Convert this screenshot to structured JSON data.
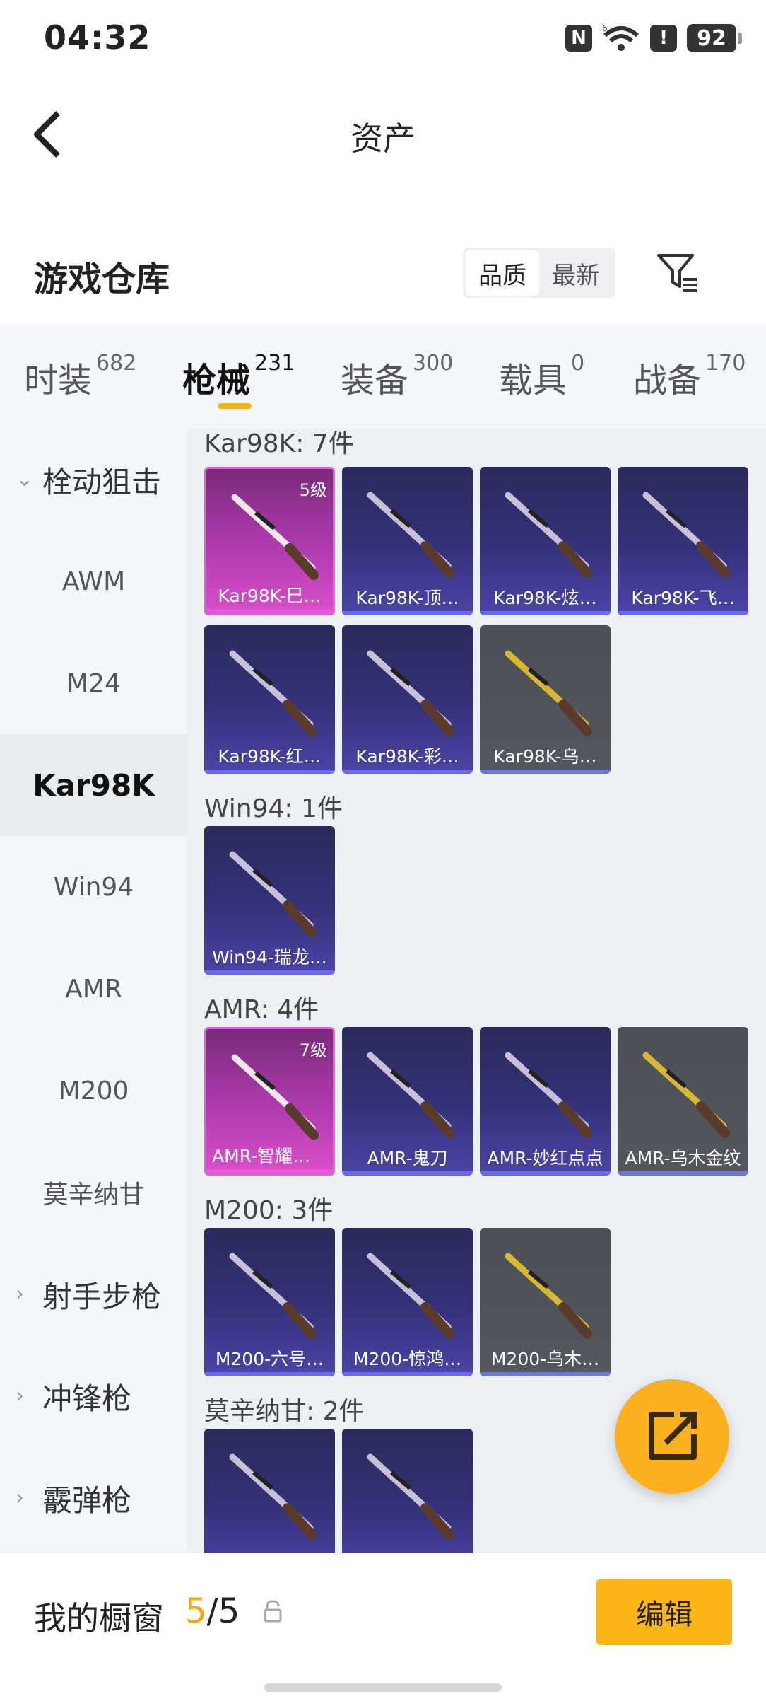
{
  "status_bar": {
    "time": "04:32",
    "battery": "92",
    "signal_label": "6"
  },
  "header": {
    "title": "资产"
  },
  "section": {
    "title": "游戏仓库",
    "sort_options": [
      "品质",
      "最新"
    ],
    "active_sort": "品质"
  },
  "tabs": [
    {
      "label": "时装",
      "count": "682"
    },
    {
      "label": "枪械",
      "count": "231"
    },
    {
      "label": "装备",
      "count": "300"
    },
    {
      "label": "载具",
      "count": "0"
    },
    {
      "label": "战备",
      "count": "170"
    }
  ],
  "active_tab": "枪械",
  "sidebar": {
    "items": [
      {
        "label": "栓动狙击",
        "type": "category",
        "expanded": true
      },
      {
        "label": "AWM",
        "type": "sub"
      },
      {
        "label": "M24",
        "type": "sub"
      },
      {
        "label": "Kar98K",
        "type": "sub",
        "selected": true
      },
      {
        "label": "Win94",
        "type": "sub"
      },
      {
        "label": "AMR",
        "type": "sub"
      },
      {
        "label": "M200",
        "type": "sub"
      },
      {
        "label": "莫辛纳甘",
        "type": "sub"
      },
      {
        "label": "射手步枪",
        "type": "category",
        "expanded": false
      },
      {
        "label": "冲锋枪",
        "type": "category",
        "expanded": false
      },
      {
        "label": "霰弹枪",
        "type": "category",
        "expanded": false
      }
    ]
  },
  "groups": [
    {
      "title": "Kar98K: 7件",
      "items": [
        {
          "name": "Kar98K-巳…",
          "tier": "pink",
          "level": "5级"
        },
        {
          "name": "Kar98K-顶…",
          "tier": "purple"
        },
        {
          "name": "Kar98K-炫…",
          "tier": "purple"
        },
        {
          "name": "Kar98K-飞…",
          "tier": "purple"
        },
        {
          "name": "Kar98K-红…",
          "tier": "purple"
        },
        {
          "name": "Kar98K-彩…",
          "tier": "purple"
        },
        {
          "name": "Kar98K-乌…",
          "tier": "gray"
        }
      ]
    },
    {
      "title": "Win94: 1件",
      "items": [
        {
          "name": "Win94-瑞龙…",
          "tier": "purple"
        }
      ]
    },
    {
      "title": "AMR: 4件",
      "items": [
        {
          "name": "AMR-智耀战神",
          "tier": "pink",
          "level": "7级"
        },
        {
          "name": "AMR-鬼刀",
          "tier": "purple"
        },
        {
          "name": "AMR-妙红点点",
          "tier": "purple"
        },
        {
          "name": "AMR-乌木金纹",
          "tier": "gray"
        }
      ]
    },
    {
      "title": "M200: 3件",
      "items": [
        {
          "name": "M200-六号…",
          "tier": "purple"
        },
        {
          "name": "M200-惊鸿…",
          "tier": "purple"
        },
        {
          "name": "M200-乌木…",
          "tier": "gray"
        }
      ]
    },
    {
      "title": "莫辛纳甘: 2件",
      "items": [
        {
          "name": "",
          "tier": "purple"
        },
        {
          "name": "",
          "tier": "purple"
        }
      ]
    }
  ],
  "bottom_bar": {
    "label": "我的橱窗",
    "current": "5",
    "separator": "/",
    "total": "5",
    "edit_label": "编辑"
  },
  "colors": {
    "accent": "#fbb615",
    "pink_tier": "#d94fc9",
    "purple_tier": "#4c44a8",
    "gray_tier": "#55575f"
  },
  "icons": {
    "back": "chevron-left-icon",
    "filter": "filter-icon",
    "fab": "share-external-icon",
    "lock": "lock-icon"
  }
}
